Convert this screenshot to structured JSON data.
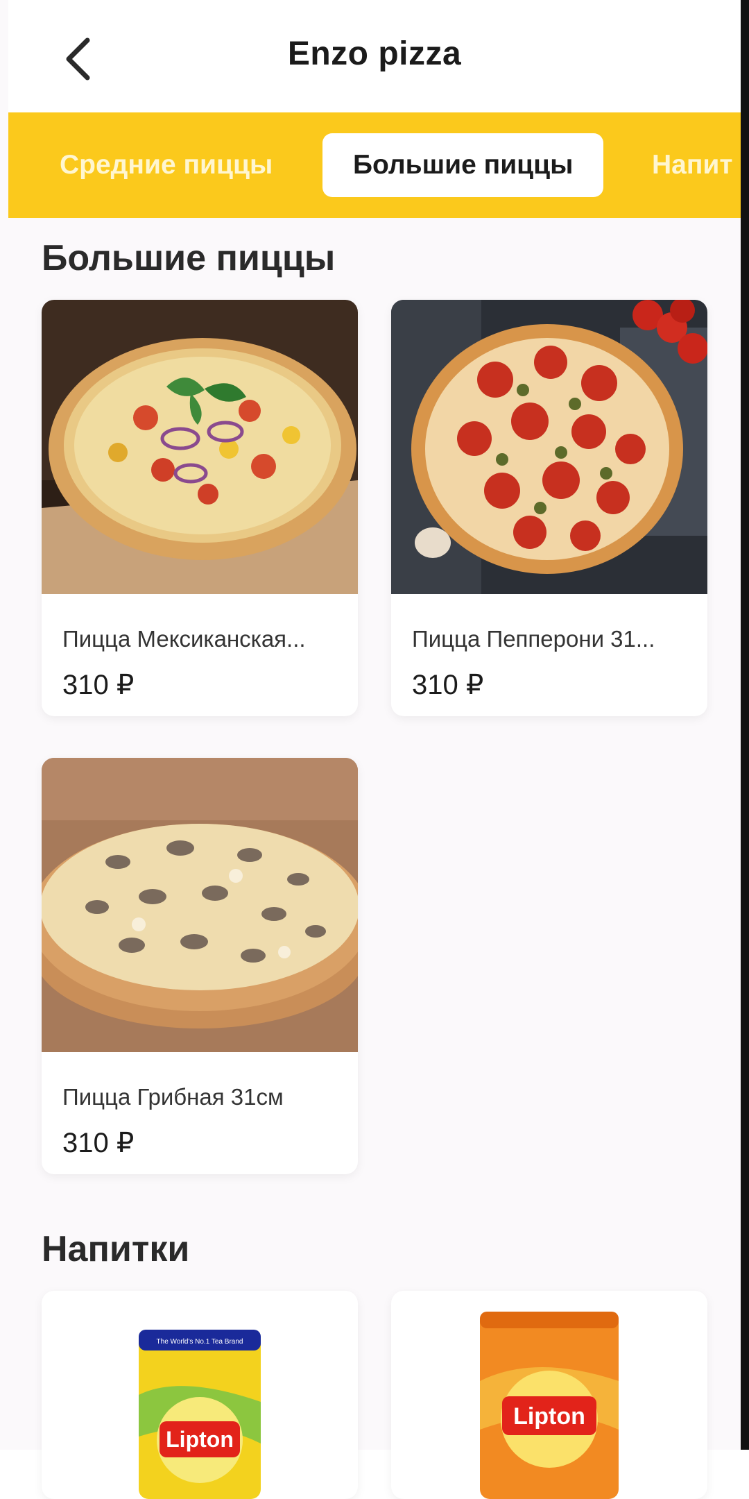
{
  "header": {
    "title": "Enzo pizza",
    "back_icon": "chevron-left-icon"
  },
  "tabs": [
    {
      "label": "Средние пиццы",
      "active": false
    },
    {
      "label": "Большие пиццы",
      "active": true
    },
    {
      "label": "Напит",
      "active": false
    }
  ],
  "sections": [
    {
      "title": "Большие пиццы",
      "items": [
        {
          "name": "Пицца Мексиканская...",
          "price": "310 ₽",
          "image": "mexican-pizza-photo"
        },
        {
          "name": "Пицца Пепперони 31...",
          "price": "310 ₽",
          "image": "pepperoni-pizza-photo"
        },
        {
          "name": "Пицца Грибная 31см",
          "price": "310 ₽",
          "image": "mushroom-pizza-photo"
        }
      ]
    },
    {
      "title": "Напитки",
      "items": [
        {
          "image": "lipton-lemon-can-photo",
          "brand": "Lipton",
          "can_tagline": "The World's No.1 Tea Brand"
        },
        {
          "image": "lipton-peach-can-photo",
          "brand": "Lipton"
        }
      ]
    }
  ],
  "colors": {
    "accent": "#fbc91c",
    "background": "#fbf9fb",
    "card": "#ffffff"
  }
}
